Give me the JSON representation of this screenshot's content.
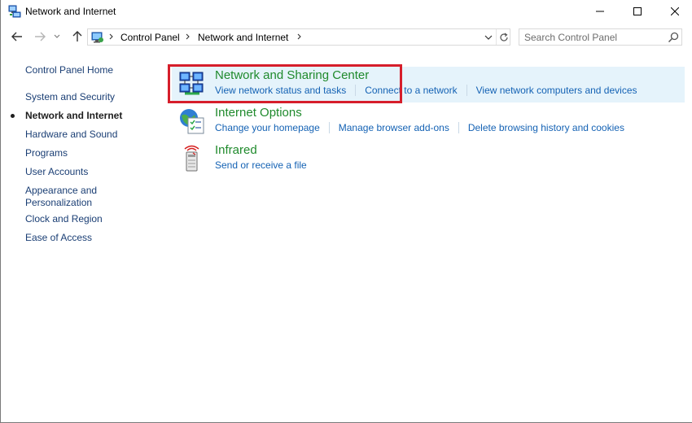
{
  "window": {
    "title": "Network and Internet"
  },
  "navigation": {
    "breadcrumbs": [
      "Control Panel",
      "Network and Internet"
    ],
    "search_placeholder": "Search Control Panel"
  },
  "sidebar": {
    "items": [
      {
        "label": "Control Panel Home",
        "active": false
      },
      {
        "label": "System and Security",
        "active": false
      },
      {
        "label": "Network and Internet",
        "active": true
      },
      {
        "label": "Hardware and Sound",
        "active": false
      },
      {
        "label": "Programs",
        "active": false
      },
      {
        "label": "User Accounts",
        "active": false
      },
      {
        "label": "Appearance and",
        "label2": "Personalization",
        "active": false
      },
      {
        "label": "Clock and Region",
        "active": false
      },
      {
        "label": "Ease of Access",
        "active": false
      }
    ]
  },
  "categories": [
    {
      "title": "Network and Sharing Center",
      "icon": "network-sharing-icon",
      "links": [
        "View network status and tasks",
        "Connect to a network",
        "View network computers and devices"
      ],
      "highlighted": true
    },
    {
      "title": "Internet Options",
      "icon": "internet-options-icon",
      "links": [
        "Change your homepage",
        "Manage browser add-ons",
        "Delete browsing history and cookies"
      ],
      "highlighted": false
    },
    {
      "title": "Infrared",
      "icon": "infrared-icon",
      "links": [
        "Send or receive a file"
      ],
      "highlighted": false
    }
  ],
  "colors": {
    "category_title": "#1f8a2c",
    "link": "#1462b4",
    "sidebar_link": "#1a3e74",
    "highlight_bg": "#e5f3fb",
    "annotation_box": "#d61e2b"
  }
}
